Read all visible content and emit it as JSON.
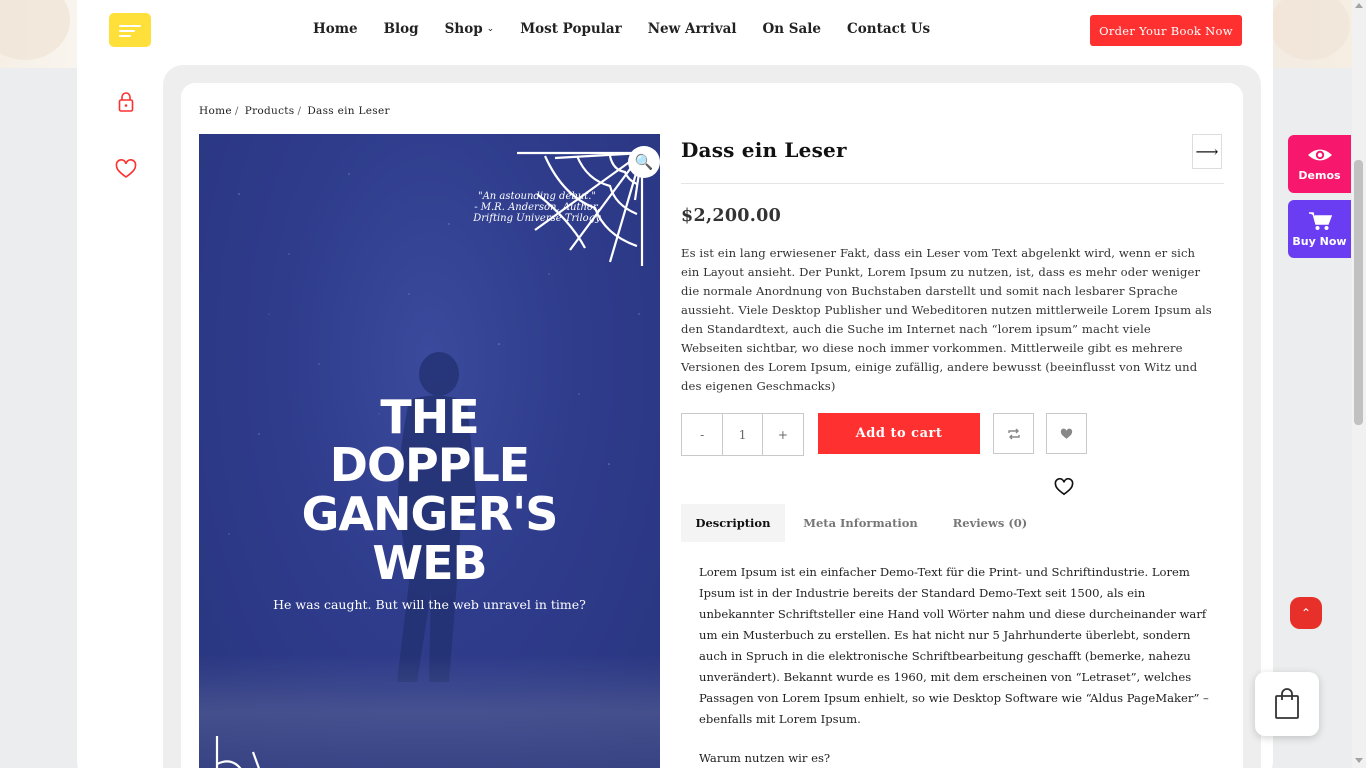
{
  "header": {
    "nav": [
      {
        "label": "Home"
      },
      {
        "label": "Blog"
      },
      {
        "label": "Shop"
      },
      {
        "label": "Most Popular"
      },
      {
        "label": "New Arrival"
      },
      {
        "label": "On Sale"
      },
      {
        "label": "Contact Us"
      }
    ],
    "order_button": "Order Your Book Now"
  },
  "rail": {
    "icons": [
      "lock-icon",
      "heart-icon"
    ]
  },
  "breadcrumb": {
    "items": [
      "Home",
      "Products",
      "Dass ein Leser"
    ],
    "separator": "/"
  },
  "cover": {
    "quote_line1": "\"An astounding debut.\"",
    "quote_line2": "- M.R. Anderson, Author,",
    "quote_line3": "Drifting Universe Trilogy",
    "title_line1": "THE",
    "title_line2": "DOPPLE",
    "title_line3": "GANGER'S",
    "title_line4": "WEB",
    "tagline": "He was caught. But will the web unravel in time?"
  },
  "product": {
    "title": "Dass ein Leser",
    "price": "$2,200.00",
    "description": "Es ist ein lang erwiesener Fakt, dass ein Leser vom Text abgelenkt wird, wenn er sich ein Layout ansieht. Der Punkt, Lorem Ipsum zu nutzen, ist, dass es mehr oder weniger die normale Anordnung von Buchstaben darstellt und somit nach lesbarer Sprache aussieht. Viele Desktop Publisher und Webeditoren nutzen mittlerweile Lorem Ipsum als den Standardtext, auch die Suche im Internet nach “lorem ipsum” macht viele Webseiten sichtbar, wo diese noch immer vorkommen. Mittlerweile gibt es mehrere Versionen des Lorem Ipsum, einige zufällig, andere bewusst (beeinflusst von Witz und des eigenen Geschmacks)",
    "quantity": "1",
    "minus": "-",
    "plus": "+",
    "add_to_cart": "Add to cart"
  },
  "tabs": [
    {
      "label": "Description"
    },
    {
      "label": "Meta Information"
    },
    {
      "label": "Reviews (0)"
    }
  ],
  "tab_content": {
    "description": "Lorem Ipsum ist ein einfacher Demo-Text für die Print- und Schriftindustrie. Lorem Ipsum ist in der Industrie bereits der Standard Demo-Text seit 1500, als ein unbekannter Schriftsteller eine Hand voll Wörter nahm und diese durcheinander warf um ein Musterbuch zu erstellen. Es hat nicht nur 5 Jahrhunderte überlebt, sondern auch in Spruch in die elektronische Schriftbearbeitung geschafft (bemerke, nahezu unverändert). Bekannt wurde es 1960, mit dem erscheinen von “Letraset”, welches Passagen von Lorem Ipsum enhielt, so wie Desktop Software wie “Aldus PageMaker” – ebenfalls mit Lorem Ipsum.",
    "heading": "Warum nutzen wir es?"
  },
  "floating": {
    "demos": "Demos",
    "buy_now": "Buy Now"
  },
  "colors": {
    "accent_red": "#fe3030",
    "menu_yellow": "#ffe03a",
    "demos_pink": "#f7186d",
    "buynow_purple": "#6a3df2",
    "cover_blue": "#2f3c8c"
  }
}
